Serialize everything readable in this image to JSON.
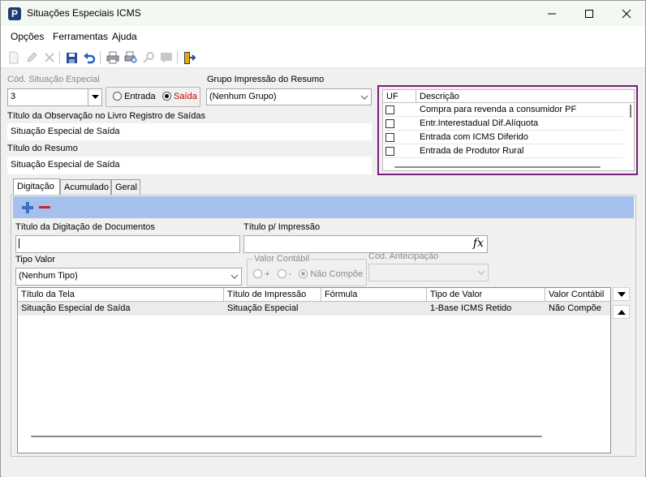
{
  "window": {
    "title": "Situações Especiais ICMS",
    "app_icon_letter": "P"
  },
  "menu": [
    "Opções",
    "Ferramentas",
    "Ajuda"
  ],
  "toolbar": {
    "icons": [
      "new-document-icon",
      "edit-icon",
      "delete-icon",
      "save-icon",
      "undo-icon",
      "print-icon",
      "print-preview-icon",
      "search-icon",
      "comment-icon",
      "exit-icon"
    ]
  },
  "form": {
    "cod_label": "Cód. Situação Especial",
    "cod_value": "3",
    "radio_entrada": "Entrada",
    "radio_saida": "Saída",
    "selected_radio": "Saída",
    "grupo_label": "Grupo Impressão do Resumo",
    "grupo_value": "(Nenhum Grupo)",
    "titulo_obs_label": "Título da Observação no Livro Registro de Saídas",
    "titulo_obs_value": "Situação Especial de Saída",
    "titulo_resumo_label": "Título do Resumo",
    "titulo_resumo_value": "Situação Especial de Saída"
  },
  "uf_grid": {
    "headers": [
      "UF",
      "Descrição"
    ],
    "rows": [
      {
        "checked": false,
        "descricao": "Compra para revenda a consumidor PF"
      },
      {
        "checked": false,
        "descricao": "Entr.Interestadual Dif.Alíquota"
      },
      {
        "checked": false,
        "descricao": "Entrada com ICMS Diferido"
      },
      {
        "checked": false,
        "descricao": "Entrada de Produtor Rural"
      }
    ]
  },
  "tabs": [
    "Digitação",
    "Acumulado",
    "Geral"
  ],
  "active_tab": "Digitação",
  "digitacao": {
    "titulo_dig_label": "Título da Digitação de Documentos",
    "titulo_dig_value": "",
    "titulo_imp_label": "Título p/ Impressão",
    "titulo_imp_value": "",
    "fx_label": "fx",
    "tipo_valor_label": "Tipo Valor",
    "tipo_valor_value": "(Nenhum Tipo)",
    "valor_contabil_label": "Valor Contábil",
    "vc_plus": "+",
    "vc_minus": "-",
    "vc_nao_compoe": "Não Compõe",
    "cod_antecipacao_label": "Cod. Antecipação",
    "cod_antecipacao_value": ""
  },
  "main_grid": {
    "headers": [
      "Título da Tela",
      "Título de Impressão",
      "Fórmula",
      "Tipo de Valor",
      "Valor Contábil"
    ],
    "rows": [
      [
        "Situação Especial de Saída",
        "Situação Especial",
        "",
        "1-Base ICMS Retido",
        "Não Compõe"
      ]
    ]
  },
  "colors": {
    "uf_panel_border": "#7a1f7a",
    "action_bar": "#a6c0ee",
    "add_icon": "#3f6fc4",
    "remove_icon": "#d32020",
    "radio_saida_text": "#c00000"
  }
}
